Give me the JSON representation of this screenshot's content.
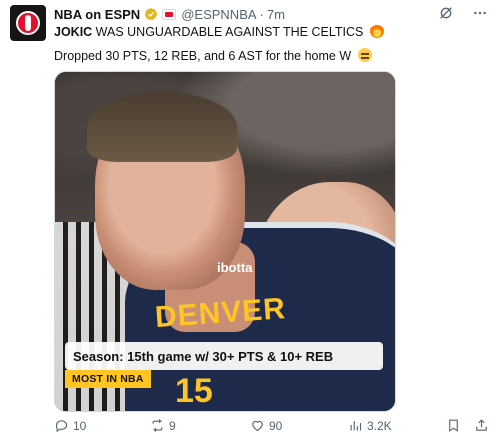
{
  "tweet": {
    "author_name": "NBA on ESPN",
    "handle": "@ESPNNBA",
    "separator": "·",
    "time": "7m",
    "text_bold": "JOKIC",
    "text_rest": " WAS UNGUARDABLE AGAINST THE CELTICS",
    "text_line2": "Dropped 30 PTS, 12 REB, and 6 AST for the home W"
  },
  "media": {
    "jersey_text": "DENVER",
    "jersey_sponsor": "ibotta",
    "jersey_number": "15",
    "stat_card": "Season: 15th game w/ 30+ PTS & 10+ REB",
    "tag": "MOST IN NBA"
  },
  "footer": {
    "replies": "10",
    "reposts": "9",
    "likes": "90",
    "views": "3.2K"
  },
  "icons": {
    "verified": "verified-badge-icon",
    "org_badge": "espn-affiliate-badge-icon",
    "grok": "grok-icon",
    "more": "more-icon",
    "reply": "reply-icon",
    "repost": "repost-icon",
    "like": "heart-icon",
    "views": "views-icon",
    "bookmark": "bookmark-icon",
    "share": "share-icon"
  },
  "colors": {
    "text": "#0f1419",
    "muted": "#536471",
    "verified_gold": "#e2b719",
    "nba_red": "#e4112c",
    "denver_navy": "#1d2a4a",
    "denver_gold": "#fec524"
  }
}
